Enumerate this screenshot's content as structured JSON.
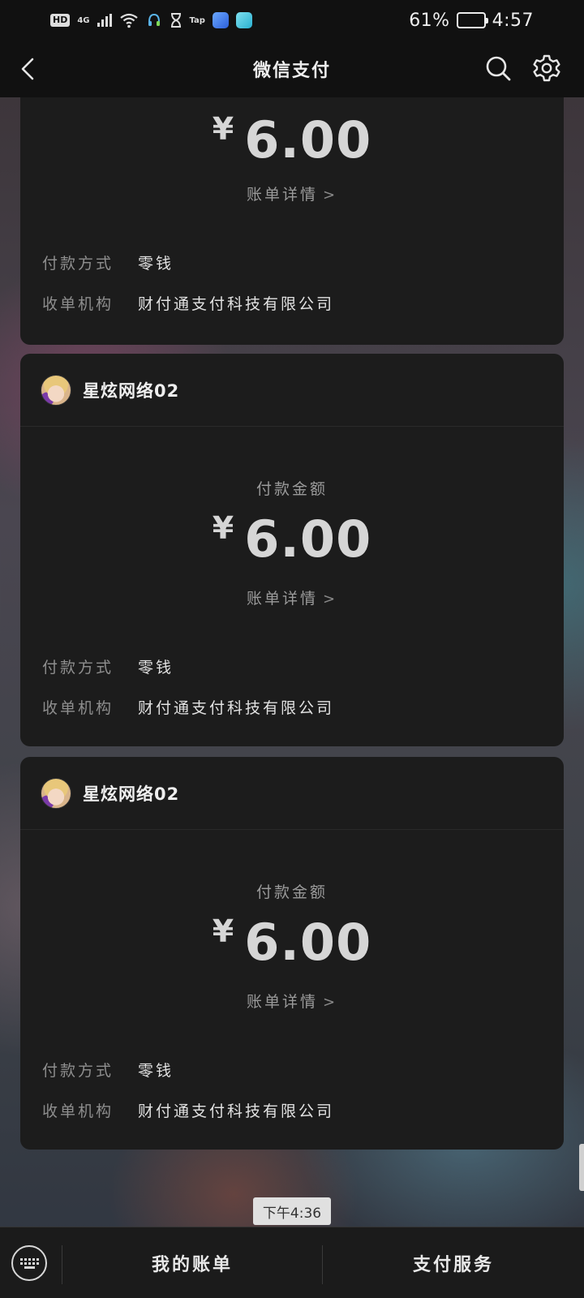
{
  "status_bar": {
    "hd": "HD",
    "network": "4G",
    "tap": "Tap",
    "battery_percent": "61%",
    "battery_level": 0.61,
    "time": "4:57"
  },
  "nav": {
    "title": "微信支付"
  },
  "cards": [
    {
      "merchant": "",
      "amount_label": "",
      "currency": "¥",
      "amount": "6.00",
      "detail_link": "账单详情",
      "rows": [
        {
          "label": "付款方式",
          "value": "零钱"
        },
        {
          "label": "收单机构",
          "value": "财付通支付科技有限公司"
        }
      ]
    },
    {
      "merchant": "星炫网络02",
      "amount_label": "付款金额",
      "currency": "¥",
      "amount": "6.00",
      "detail_link": "账单详情",
      "rows": [
        {
          "label": "付款方式",
          "value": "零钱"
        },
        {
          "label": "收单机构",
          "value": "财付通支付科技有限公司"
        }
      ]
    },
    {
      "merchant": "星炫网络02",
      "amount_label": "付款金额",
      "currency": "¥",
      "amount": "6.00",
      "detail_link": "账单详情",
      "rows": [
        {
          "label": "付款方式",
          "value": "零钱"
        },
        {
          "label": "收单机构",
          "value": "财付通支付科技有限公司"
        }
      ]
    }
  ],
  "time_tag": "下午4:36",
  "bottom_bar": {
    "my_bills": "我的账单",
    "pay_services": "支付服务"
  }
}
